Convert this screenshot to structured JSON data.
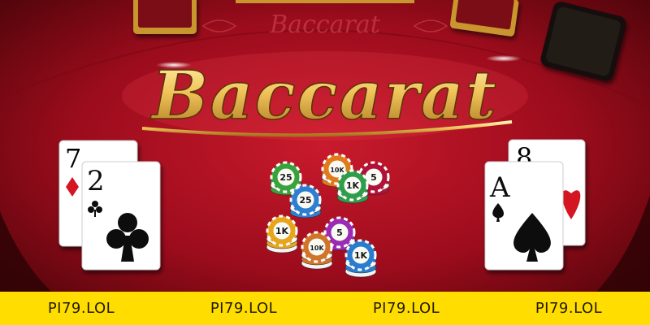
{
  "logo": {
    "title": "Baccarat",
    "felt_text": "Baccarat"
  },
  "hands": {
    "left": [
      {
        "rank": "7",
        "suit": "diamond-icon",
        "color": "#d41620"
      },
      {
        "rank": "2",
        "suit": "club-icon",
        "color": "#111111"
      }
    ],
    "right": [
      {
        "rank": "8",
        "suit": "heart-icon",
        "color": "#d41620"
      },
      {
        "rank": "A",
        "suit": "spade-icon",
        "color": "#111111"
      }
    ]
  },
  "chips": [
    {
      "label": "25",
      "color": "#3aa23c"
    },
    {
      "label": "10K",
      "color": "#e07a1c"
    },
    {
      "label": "5",
      "color": "#b0123a"
    },
    {
      "label": "25",
      "color": "#2f7fd0"
    },
    {
      "label": "1K",
      "color": "#2f9d4a"
    },
    {
      "label": "1K",
      "color": "#e6a51c"
    },
    {
      "label": "5",
      "color": "#9b2bb3"
    },
    {
      "label": "10K",
      "color": "#d0742a"
    },
    {
      "label": "1K",
      "color": "#2a7ccf"
    }
  ],
  "banner": {
    "items": [
      "PI79.LOL",
      "PI79.LOL",
      "PI79.LOL",
      "PI79.LOL"
    ]
  },
  "colors": {
    "felt": "#9c0c1c",
    "gold": "#e8b64c",
    "banner": "#ffdd00"
  }
}
